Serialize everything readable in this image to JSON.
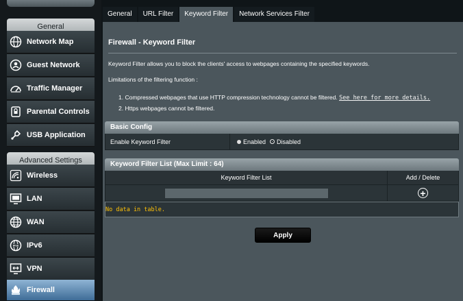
{
  "sidebar": {
    "general_header": "General",
    "advanced_header": "Advanced Settings",
    "general_items": [
      {
        "label": "Network Map",
        "icon": "globe-network-icon"
      },
      {
        "label": "Guest Network",
        "icon": "guest-network-icon"
      },
      {
        "label": "Traffic Manager",
        "icon": "gauge-icon"
      },
      {
        "label": "Parental Controls",
        "icon": "lock-icon"
      },
      {
        "label": "USB Application",
        "icon": "usb-puzzle-icon"
      }
    ],
    "advanced_items": [
      {
        "label": "Wireless",
        "icon": "wireless-icon"
      },
      {
        "label": "LAN",
        "icon": "monitor-icon"
      },
      {
        "label": "WAN",
        "icon": "globe-icon"
      },
      {
        "label": "IPv6",
        "icon": "ipv6-globe-icon"
      },
      {
        "label": "VPN",
        "icon": "vpn-icon"
      },
      {
        "label": "Firewall",
        "icon": "firewall-icon"
      }
    ]
  },
  "tabs": [
    {
      "label": "General",
      "active": false
    },
    {
      "label": "URL Filter",
      "active": false
    },
    {
      "label": "Keyword Filter",
      "active": true
    },
    {
      "label": "Network Services Filter",
      "active": false
    }
  ],
  "main": {
    "title": "Firewall - Keyword Filter",
    "description": "Keyword Filter allows you to block the clients' access to webpages containing the specified keywords.",
    "limitations_heading": "Limitations of the filtering function :",
    "limitation_1": "1. Compressed webpages that use HTTP compression technology cannot be filtered.",
    "limitation_1_link": "See here for more details.",
    "limitation_2": "2. Https webpages cannot be filtered."
  },
  "basic_config": {
    "header": "Basic Config",
    "enable_label": "Enable Keyword Filter",
    "enabled_option": "Enabled",
    "disabled_option": "Disabled",
    "selected": "Disabled"
  },
  "keyword_list": {
    "header": "Keyword Filter List (Max Limit : 64)",
    "col_list": "Keyword Filter List",
    "col_action": "Add / Delete",
    "input_value": "",
    "empty_text": "No data in table."
  },
  "apply_label": "Apply",
  "colors": {
    "accent_active": "#3e6c97",
    "no_data": "#ffc107",
    "panel": "#4b565c"
  }
}
